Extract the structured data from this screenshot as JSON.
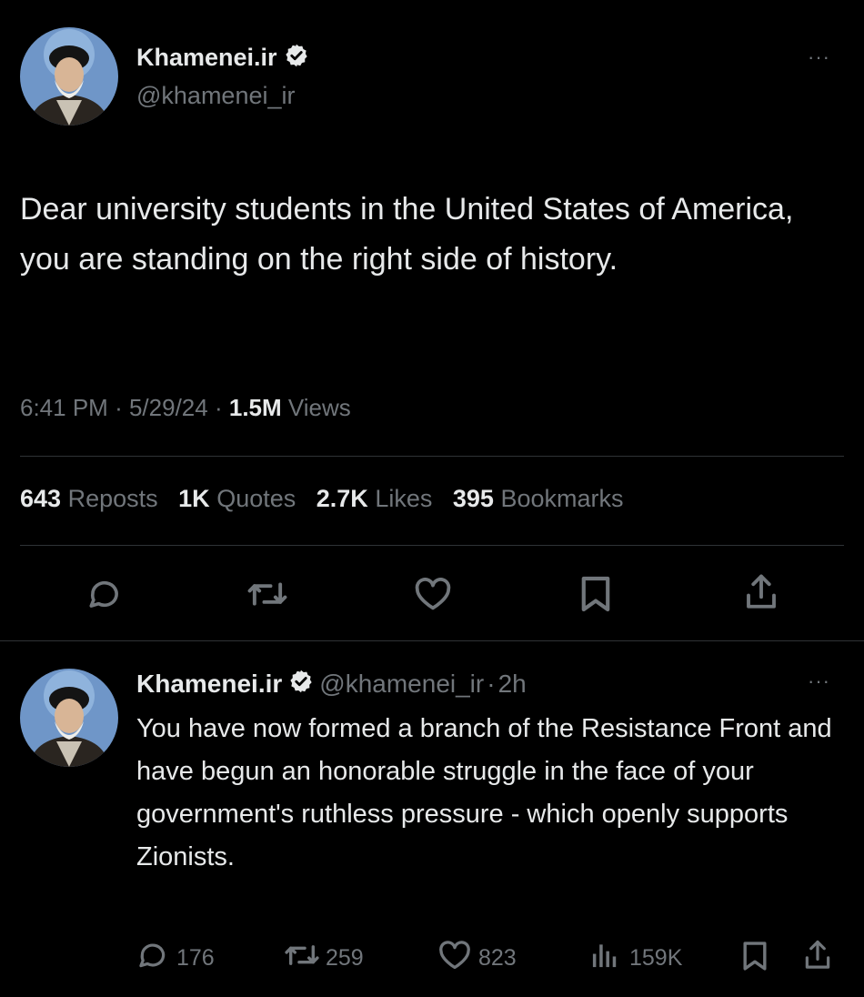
{
  "tweet": {
    "author_name": "Khamenei.ir",
    "author_handle": "@khamenei_ir",
    "text": "Dear university students in the United States of America, you are standing on the right side of history.",
    "time": "6:41 PM",
    "date": "5/29/24",
    "views_count": "1.5M",
    "views_label": "Views",
    "sep": "·",
    "stats": {
      "reposts_count": "643",
      "reposts_label": "Reposts",
      "quotes_count": "1K",
      "quotes_label": "Quotes",
      "likes_count": "2.7K",
      "likes_label": "Likes",
      "bookmarks_count": "395",
      "bookmarks_label": "Bookmarks"
    },
    "more_label": "···"
  },
  "reply": {
    "author_name": "Khamenei.ir",
    "author_handle": "@khamenei_ir",
    "sep": "·",
    "age": "2h",
    "text": "You have now formed a branch of the Resistance Front and have begun an honorable struggle in the face of your government's ruthless pressure - which openly supports Zionists.",
    "replies": "176",
    "reposts": "259",
    "likes": "823",
    "views": "159K",
    "more_label": "···"
  },
  "colors": {
    "background": "#000000",
    "text": "#e7e9ea",
    "muted": "#71767b",
    "verified": "#e7e9ea",
    "divider": "#2f3336"
  },
  "icons": [
    "verified-badge-icon",
    "more-icon",
    "reply-icon",
    "repost-icon",
    "like-icon",
    "bookmark-icon",
    "share-icon",
    "views-icon"
  ]
}
